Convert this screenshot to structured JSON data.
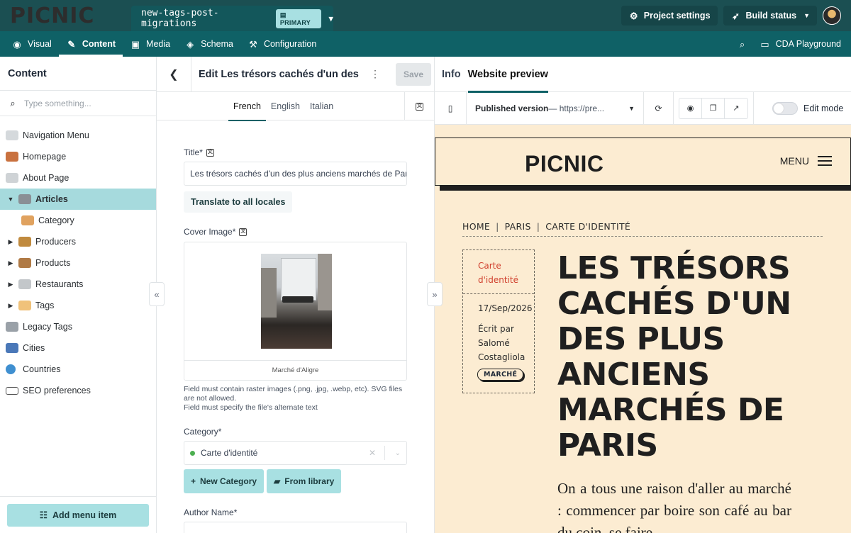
{
  "app": {
    "logo": "PICNIC",
    "environment": "new-tags-post-migrations",
    "environment_badge": "PRIMARY",
    "project_settings": "Project settings",
    "build_status": "Build status"
  },
  "nav": {
    "items": [
      {
        "label": "Visual",
        "icon": "eye-icon"
      },
      {
        "label": "Content",
        "icon": "edit-icon"
      },
      {
        "label": "Media",
        "icon": "image-icon"
      },
      {
        "label": "Schema",
        "icon": "layers-icon"
      },
      {
        "label": "Configuration",
        "icon": "config-icon"
      }
    ],
    "active": "Content",
    "cda": "CDA Playground"
  },
  "sidebar": {
    "title": "Content",
    "search_placeholder": "Type something...",
    "items": [
      {
        "label": "Navigation Menu",
        "icon": "link-icon",
        "color": "#9aa1a8"
      },
      {
        "label": "Homepage",
        "icon": "house-icon",
        "color": "#c9713f"
      },
      {
        "label": "About Page",
        "icon": "page-icon",
        "color": "#8a8f95"
      },
      {
        "label": "Articles",
        "icon": "newspaper-icon",
        "color": "#8a8f95"
      },
      {
        "label": "Category",
        "icon": "box-icon",
        "color": "#e0a25f"
      },
      {
        "label": "Producers",
        "icon": "farmer-icon",
        "color": "#c08a3e"
      },
      {
        "label": "Products",
        "icon": "package-icon",
        "color": "#b07a45"
      },
      {
        "label": "Restaurants",
        "icon": "cutlery-icon",
        "color": "#9aa1a8"
      },
      {
        "label": "Tags",
        "icon": "tag-icon",
        "color": "#f0c27a"
      },
      {
        "label": "Legacy Tags",
        "icon": "skull-icon",
        "color": "#8a8f95"
      },
      {
        "label": "Cities",
        "icon": "city-icon",
        "color": "#4a78b8"
      },
      {
        "label": "Countries",
        "icon": "globe-icon",
        "color": "#3f8fd0"
      },
      {
        "label": "SEO preferences",
        "icon": "seo-icon",
        "color": "#555555"
      }
    ],
    "add_menu_item": "Add menu item"
  },
  "editor": {
    "title": "Edit Les trésors cachés d'un des",
    "save": "Save",
    "locales": [
      "French",
      "English",
      "Italian"
    ],
    "active_locale": "French",
    "title_label": "Title*",
    "title_value": "Les trésors cachés d'un des plus anciens marchés de Paris",
    "translate_all": "Translate to all locales",
    "cover_label": "Cover Image*",
    "cover_caption": "Marché d'Aligre",
    "help_1": "Field must contain raster images (.png, .jpg, .webp, etc). SVG files are not allowed.",
    "help_2": "Field must specify the file's alternate text",
    "category_label": "Category*",
    "category_value": "Carte d'identité",
    "new_category": "New Category",
    "from_library": "From library",
    "author_label": "Author Name*"
  },
  "preview": {
    "tabs": [
      "Info",
      "Website preview"
    ],
    "active_tab": "Website preview",
    "version_label": "Published version",
    "version_url": " — https://pre...",
    "edit_mode": "Edit mode",
    "site": {
      "logo": "PICNIC",
      "menu": "MENU",
      "breadcrumbs": [
        "HOME",
        "PARIS",
        "CARTE D'IDENTITÉ"
      ],
      "category": "Carte d'identité",
      "date": "17/Sep/2026",
      "author": "Écrit par Salomé Costagliola",
      "tag": "MARCHÉ",
      "headline": "LES TRÉSORS CACHÉS D'UN DES PLUS ANCIENS MARCHÉS DE PARIS",
      "body": "On a tous une raison d'aller au marché : commencer par boire son café au bar du coin, se faire"
    }
  }
}
